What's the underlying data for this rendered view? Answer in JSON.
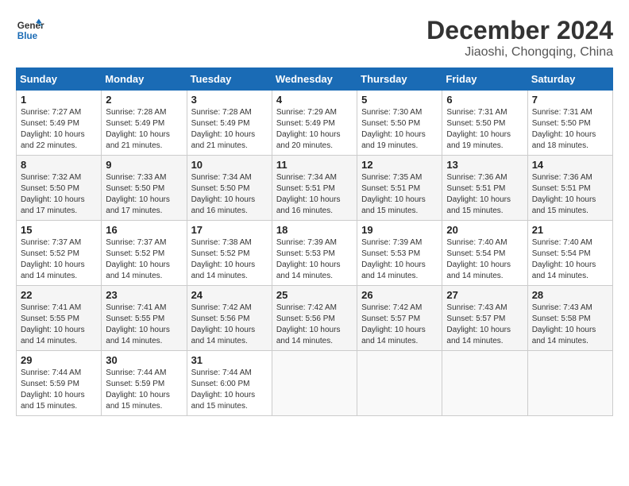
{
  "header": {
    "logo_line1": "General",
    "logo_line2": "Blue",
    "month_year": "December 2024",
    "location": "Jiaoshi, Chongqing, China"
  },
  "weekdays": [
    "Sunday",
    "Monday",
    "Tuesday",
    "Wednesday",
    "Thursday",
    "Friday",
    "Saturday"
  ],
  "weeks": [
    [
      {
        "day": "1",
        "info": "Sunrise: 7:27 AM\nSunset: 5:49 PM\nDaylight: 10 hours\nand 22 minutes."
      },
      {
        "day": "2",
        "info": "Sunrise: 7:28 AM\nSunset: 5:49 PM\nDaylight: 10 hours\nand 21 minutes."
      },
      {
        "day": "3",
        "info": "Sunrise: 7:28 AM\nSunset: 5:49 PM\nDaylight: 10 hours\nand 21 minutes."
      },
      {
        "day": "4",
        "info": "Sunrise: 7:29 AM\nSunset: 5:49 PM\nDaylight: 10 hours\nand 20 minutes."
      },
      {
        "day": "5",
        "info": "Sunrise: 7:30 AM\nSunset: 5:50 PM\nDaylight: 10 hours\nand 19 minutes."
      },
      {
        "day": "6",
        "info": "Sunrise: 7:31 AM\nSunset: 5:50 PM\nDaylight: 10 hours\nand 19 minutes."
      },
      {
        "day": "7",
        "info": "Sunrise: 7:31 AM\nSunset: 5:50 PM\nDaylight: 10 hours\nand 18 minutes."
      }
    ],
    [
      {
        "day": "8",
        "info": "Sunrise: 7:32 AM\nSunset: 5:50 PM\nDaylight: 10 hours\nand 17 minutes."
      },
      {
        "day": "9",
        "info": "Sunrise: 7:33 AM\nSunset: 5:50 PM\nDaylight: 10 hours\nand 17 minutes."
      },
      {
        "day": "10",
        "info": "Sunrise: 7:34 AM\nSunset: 5:50 PM\nDaylight: 10 hours\nand 16 minutes."
      },
      {
        "day": "11",
        "info": "Sunrise: 7:34 AM\nSunset: 5:51 PM\nDaylight: 10 hours\nand 16 minutes."
      },
      {
        "day": "12",
        "info": "Sunrise: 7:35 AM\nSunset: 5:51 PM\nDaylight: 10 hours\nand 15 minutes."
      },
      {
        "day": "13",
        "info": "Sunrise: 7:36 AM\nSunset: 5:51 PM\nDaylight: 10 hours\nand 15 minutes."
      },
      {
        "day": "14",
        "info": "Sunrise: 7:36 AM\nSunset: 5:51 PM\nDaylight: 10 hours\nand 15 minutes."
      }
    ],
    [
      {
        "day": "15",
        "info": "Sunrise: 7:37 AM\nSunset: 5:52 PM\nDaylight: 10 hours\nand 14 minutes."
      },
      {
        "day": "16",
        "info": "Sunrise: 7:37 AM\nSunset: 5:52 PM\nDaylight: 10 hours\nand 14 minutes."
      },
      {
        "day": "17",
        "info": "Sunrise: 7:38 AM\nSunset: 5:52 PM\nDaylight: 10 hours\nand 14 minutes."
      },
      {
        "day": "18",
        "info": "Sunrise: 7:39 AM\nSunset: 5:53 PM\nDaylight: 10 hours\nand 14 minutes."
      },
      {
        "day": "19",
        "info": "Sunrise: 7:39 AM\nSunset: 5:53 PM\nDaylight: 10 hours\nand 14 minutes."
      },
      {
        "day": "20",
        "info": "Sunrise: 7:40 AM\nSunset: 5:54 PM\nDaylight: 10 hours\nand 14 minutes."
      },
      {
        "day": "21",
        "info": "Sunrise: 7:40 AM\nSunset: 5:54 PM\nDaylight: 10 hours\nand 14 minutes."
      }
    ],
    [
      {
        "day": "22",
        "info": "Sunrise: 7:41 AM\nSunset: 5:55 PM\nDaylight: 10 hours\nand 14 minutes."
      },
      {
        "day": "23",
        "info": "Sunrise: 7:41 AM\nSunset: 5:55 PM\nDaylight: 10 hours\nand 14 minutes."
      },
      {
        "day": "24",
        "info": "Sunrise: 7:42 AM\nSunset: 5:56 PM\nDaylight: 10 hours\nand 14 minutes."
      },
      {
        "day": "25",
        "info": "Sunrise: 7:42 AM\nSunset: 5:56 PM\nDaylight: 10 hours\nand 14 minutes."
      },
      {
        "day": "26",
        "info": "Sunrise: 7:42 AM\nSunset: 5:57 PM\nDaylight: 10 hours\nand 14 minutes."
      },
      {
        "day": "27",
        "info": "Sunrise: 7:43 AM\nSunset: 5:57 PM\nDaylight: 10 hours\nand 14 minutes."
      },
      {
        "day": "28",
        "info": "Sunrise: 7:43 AM\nSunset: 5:58 PM\nDaylight: 10 hours\nand 14 minutes."
      }
    ],
    [
      {
        "day": "29",
        "info": "Sunrise: 7:44 AM\nSunset: 5:59 PM\nDaylight: 10 hours\nand 15 minutes."
      },
      {
        "day": "30",
        "info": "Sunrise: 7:44 AM\nSunset: 5:59 PM\nDaylight: 10 hours\nand 15 minutes."
      },
      {
        "day": "31",
        "info": "Sunrise: 7:44 AM\nSunset: 6:00 PM\nDaylight: 10 hours\nand 15 minutes."
      },
      {
        "day": "",
        "info": ""
      },
      {
        "day": "",
        "info": ""
      },
      {
        "day": "",
        "info": ""
      },
      {
        "day": "",
        "info": ""
      }
    ]
  ]
}
